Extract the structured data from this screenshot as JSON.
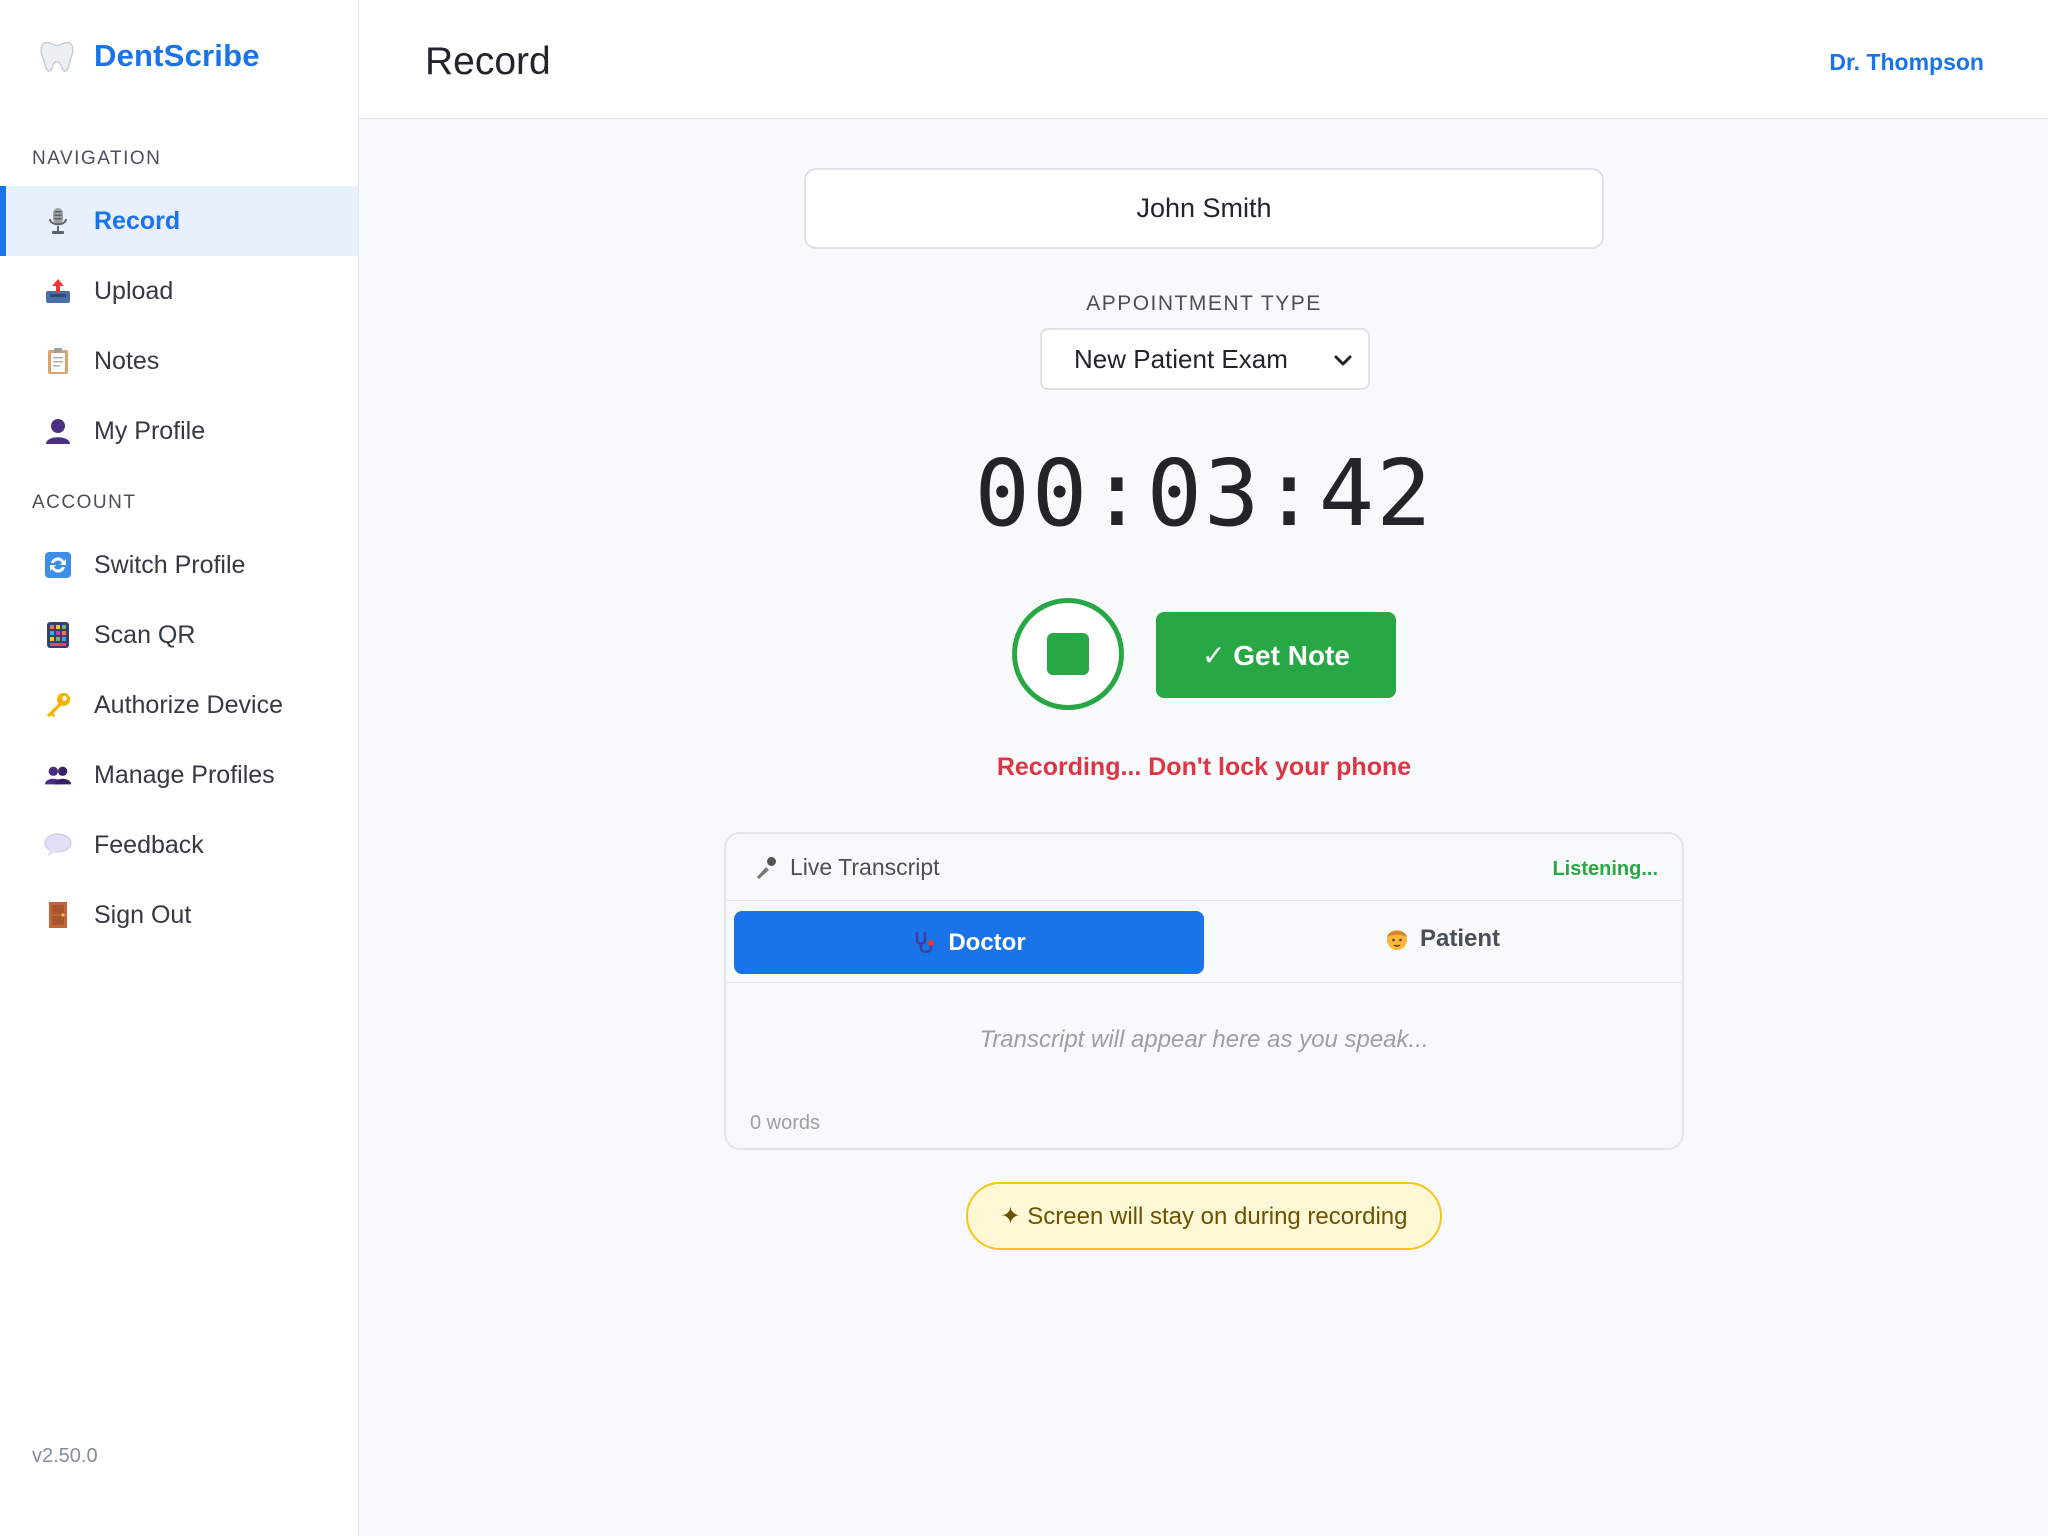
{
  "app": {
    "name": "DentScribe",
    "version": "v2.50.0"
  },
  "header": {
    "title": "Record",
    "user": "Dr. Thompson"
  },
  "sidebar": {
    "nav_label": "NAVIGATION",
    "nav_items": [
      {
        "label": "Record",
        "icon": "microphone-icon",
        "active": true
      },
      {
        "label": "Upload",
        "icon": "upload-tray-icon"
      },
      {
        "label": "Notes",
        "icon": "clipboard-icon"
      },
      {
        "label": "My Profile",
        "icon": "user-icon"
      }
    ],
    "account_label": "ACCOUNT",
    "account_items": [
      {
        "label": "Switch Profile",
        "icon": "switch-arrows-icon"
      },
      {
        "label": "Scan QR",
        "icon": "qr-scanner-icon"
      },
      {
        "label": "Authorize Device",
        "icon": "key-icon"
      },
      {
        "label": "Manage Profiles",
        "icon": "users-icon"
      },
      {
        "label": "Feedback",
        "icon": "speech-bubble-icon"
      },
      {
        "label": "Sign Out",
        "icon": "door-icon"
      }
    ]
  },
  "recording": {
    "patient_name": "John Smith",
    "appointment_label": "APPOINTMENT TYPE",
    "appointment_selected": "New Patient Exam",
    "timer": "00:03:42",
    "get_note_label": "✓ Get Note",
    "status": "Recording... Don't lock your phone"
  },
  "transcript": {
    "title": "Live Transcript",
    "status": "Listening...",
    "tab_doctor": "Doctor",
    "tab_patient": "Patient",
    "placeholder": "Transcript will appear here as you speak...",
    "word_count": "0 words"
  },
  "notice": "✦ Screen will stay on during recording",
  "colors": {
    "accent": "#1a73e8",
    "success": "#28a745",
    "danger": "#dc3545"
  }
}
